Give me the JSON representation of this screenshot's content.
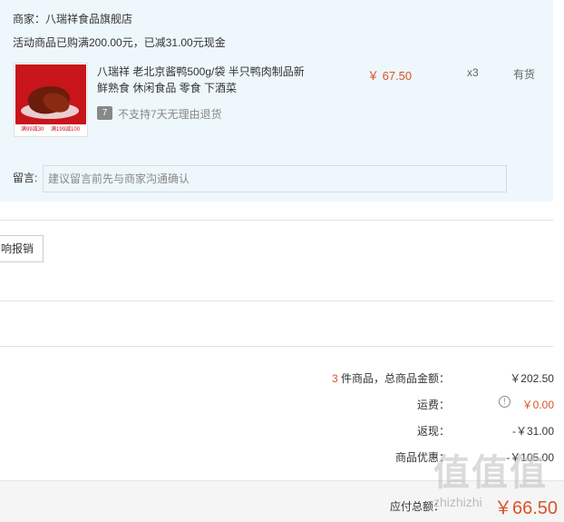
{
  "merchant": {
    "label": "商家：八瑞祥食品旗舰店"
  },
  "promo": {
    "text": "活动商品已购满200.00元，已减31.00元现金"
  },
  "product": {
    "title": "八瑞祥 老北京酱鸭500g/袋 半只鸭肉制品新鲜熟食 休闲食品 零食 下酒菜",
    "image_badges": [
      "满99减30",
      "满199减100"
    ],
    "return_icon": "7",
    "return_policy": "不支持7天无理由退货",
    "price": "￥ 67.50",
    "quantity": "x3",
    "stock": "有货"
  },
  "message": {
    "label": "留言:",
    "placeholder": "建议留言前先与商家沟通确认"
  },
  "reimburse": {
    "label": "响报销"
  },
  "summary": {
    "items_count": "3",
    "items_label": "件商品，总商品金额：",
    "items_total": "￥202.50",
    "shipping_label": "运费：",
    "shipping_value": "￥0.00",
    "cashback_label": "返现：",
    "cashback_value": "-￥31.00",
    "discount_label": "商品优惠：",
    "discount_value": "-￥105.00"
  },
  "payable": {
    "label": "应付总额：",
    "value": "￥66.50"
  },
  "watermark": {
    "logo": "值值值",
    "site": "zhizhizhi"
  },
  "colors": {
    "accent": "#d9532b",
    "panel": "#eef7fb"
  }
}
